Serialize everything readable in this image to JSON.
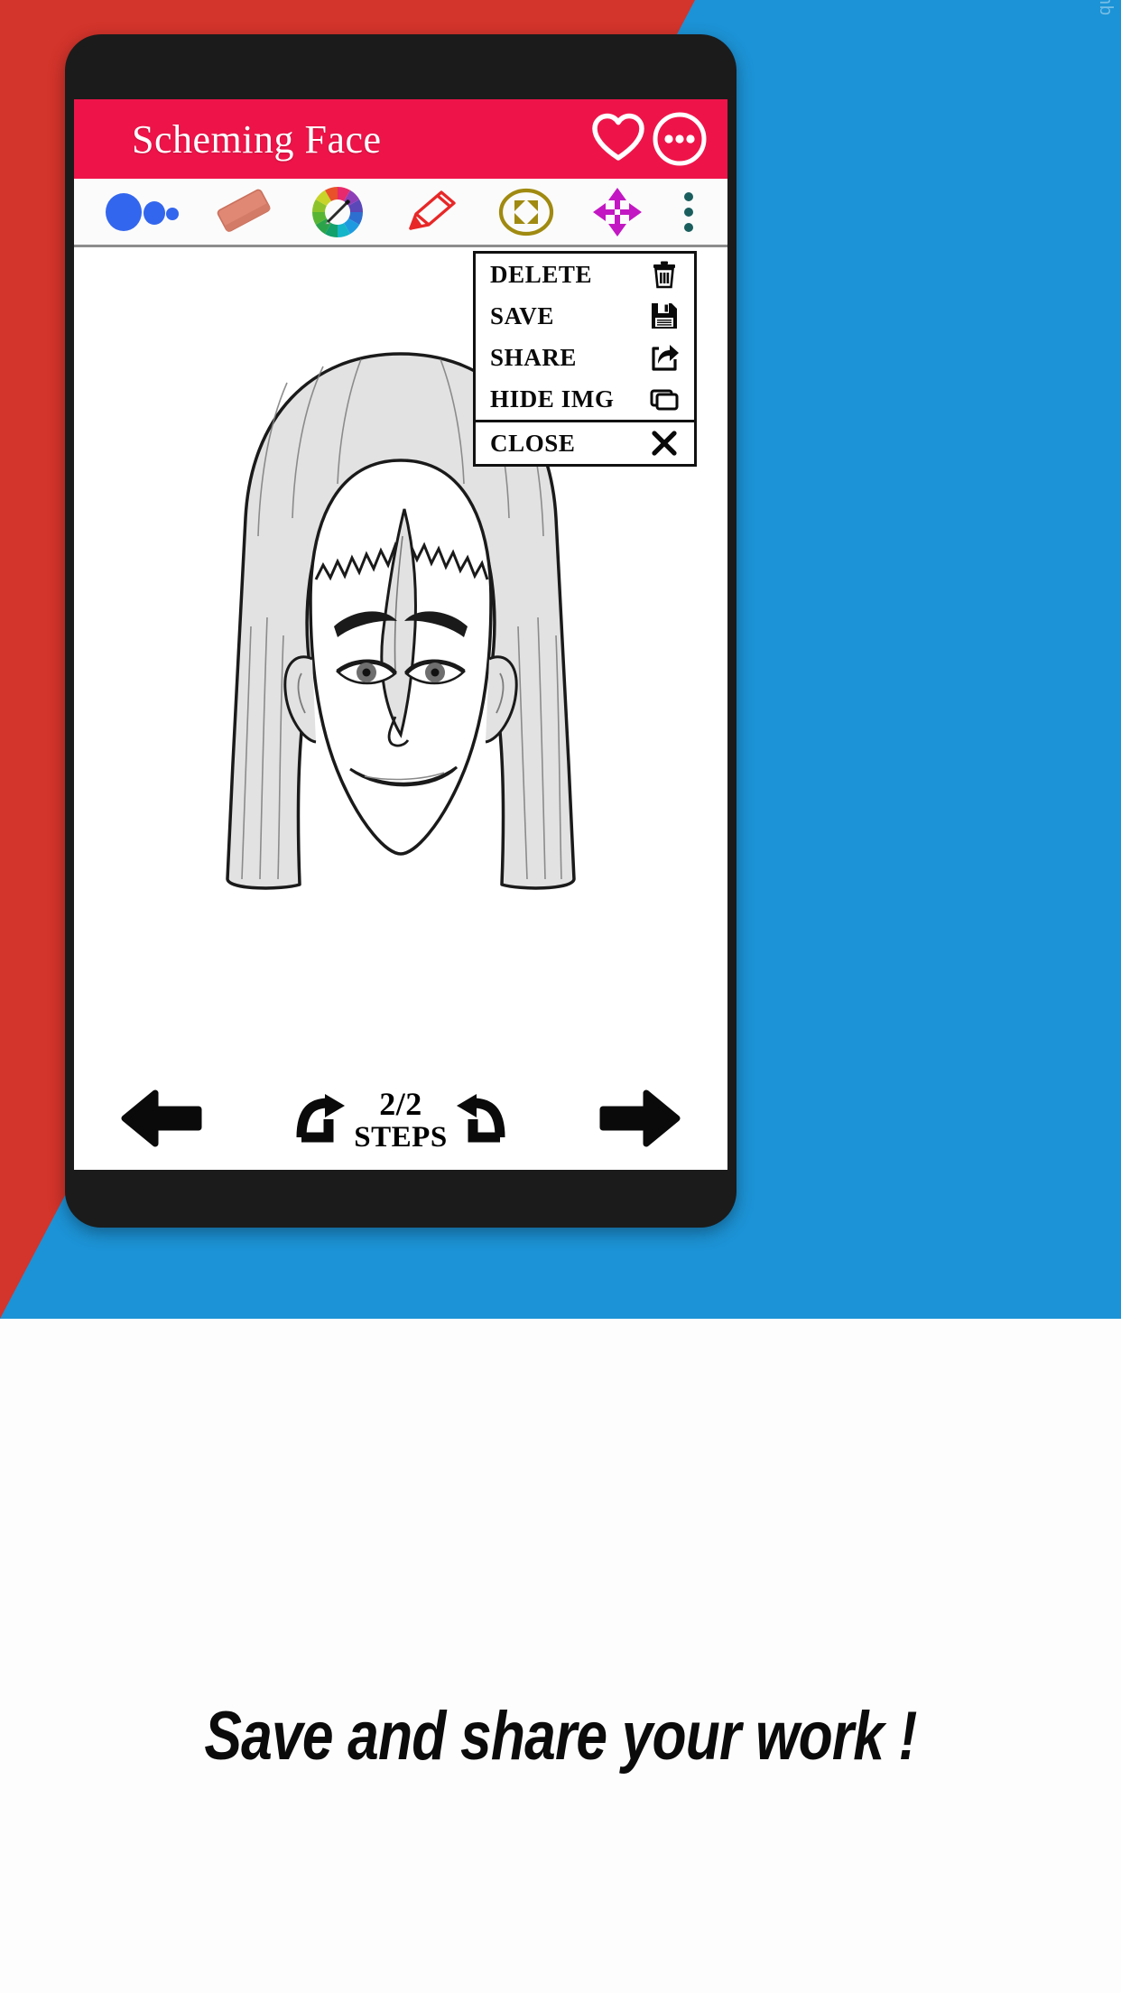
{
  "background": {
    "left_color": "#D3342B",
    "right_color": "#1C93D6",
    "bottom_color": "#FDFDFD",
    "watermark": "© xmb"
  },
  "phone": {
    "body_color": "#1B1B1B",
    "screen_color": "#FFFFFF"
  },
  "app": {
    "header": {
      "title": "Scheming Face",
      "background_color": "#EE1449",
      "title_color": "#FFFFFF",
      "actions": [
        {
          "name": "favorite",
          "icon": "heart-icon",
          "label": "Favorite"
        },
        {
          "name": "overflow",
          "icon": "more-options-icon",
          "label": "More options"
        }
      ]
    },
    "toolbar": {
      "background_color": "#FBFBFB",
      "tools": [
        {
          "name": "brush-size",
          "icon": "brush-size-icon",
          "label": "Brush size",
          "color": "#3366EE"
        },
        {
          "name": "eraser",
          "icon": "eraser-icon",
          "label": "Eraser",
          "color": "#E08874"
        },
        {
          "name": "color-picker",
          "icon": "color-wheel-icon",
          "label": "Color picker"
        },
        {
          "name": "pencil",
          "icon": "pencil-icon",
          "label": "Pencil",
          "color": "#E82727"
        },
        {
          "name": "fullscreen",
          "icon": "fullscreen-icon",
          "label": "Fit screen",
          "color": "#A08A10"
        },
        {
          "name": "move",
          "icon": "move-arrows-icon",
          "label": "Move",
          "color": "#C317C3"
        },
        {
          "name": "more",
          "icon": "vertical-dots-icon",
          "label": "More",
          "color": "#1B5E5E"
        }
      ]
    },
    "canvas": {
      "artwork_title": "Scheming Face line drawing",
      "background_color": "#FFFFFF"
    },
    "menu": {
      "items": [
        {
          "label": "DELETE",
          "icon": "trash-icon"
        },
        {
          "label": "SAVE",
          "icon": "floppy-disk-icon"
        },
        {
          "label": "SHARE",
          "icon": "share-arrow-icon"
        },
        {
          "label": "HIDE IMG",
          "icon": "layers-icon"
        }
      ],
      "close": {
        "label": "CLOSE",
        "icon": "close-x-icon"
      }
    },
    "bottom_nav": {
      "previous": {
        "label": "Previous step",
        "icon": "arrow-left-icon"
      },
      "redo": {
        "label": "Redo",
        "icon": "redo-icon"
      },
      "undo": {
        "label": "Undo",
        "icon": "undo-icon"
      },
      "next": {
        "label": "Next step",
        "icon": "arrow-right-icon"
      },
      "steps_count": "2/2",
      "steps_label": "STEPS"
    }
  },
  "caption": "Save and share your work !"
}
